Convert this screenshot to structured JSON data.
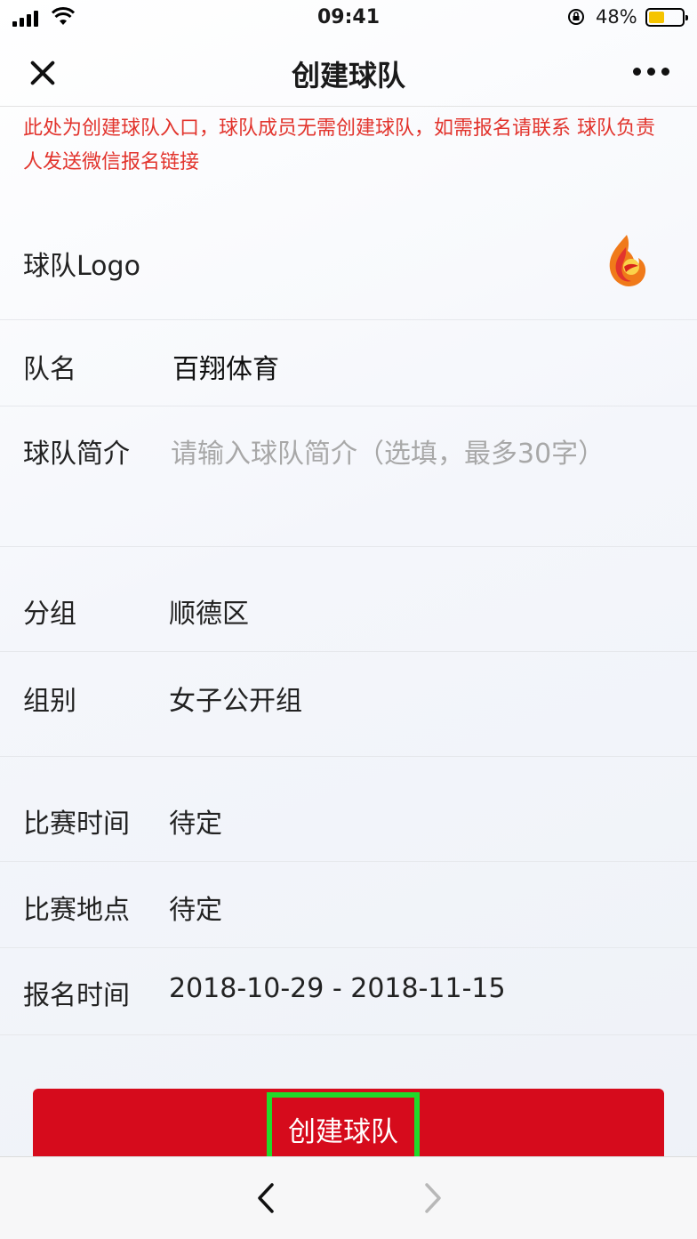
{
  "status_bar": {
    "time": "09:41",
    "battery_percent": "48%",
    "battery_level": 0.48,
    "icons": [
      "signal-icon",
      "wifi-icon",
      "rotation-lock-icon",
      "battery-icon"
    ]
  },
  "nav": {
    "title": "创建球队",
    "close_icon": "close-icon",
    "more_icon": "more-icon"
  },
  "notice": {
    "text": "此处为创建球队入口，球队成员无需创建球队，如需报名请联系 球队负责人发送微信报名链接",
    "color": "#e2342d"
  },
  "form": {
    "logo_label": "球队Logo",
    "name_label": "队名",
    "name_value": "百翔体育",
    "intro_label": "球队简介",
    "intro_placeholder": "请输入球队简介（选填，最多30字）",
    "group_label": "分组",
    "group_value": "顺德区",
    "category_label": "组别",
    "category_value": "女子公开组",
    "match_time_label": "比赛时间",
    "match_time_value": "待定",
    "match_place_label": "比赛地点",
    "match_place_value": "待定",
    "signup_time_label": "报名时间",
    "signup_time_value": "2018-10-29 - 2018-11-15"
  },
  "create_button": {
    "label": "创建球队",
    "color": "#d60b1c",
    "highlight_color": "#22d92a"
  },
  "bottom_bar": {
    "back_icon": "chevron-left-icon",
    "forward_icon": "chevron-right-icon"
  }
}
